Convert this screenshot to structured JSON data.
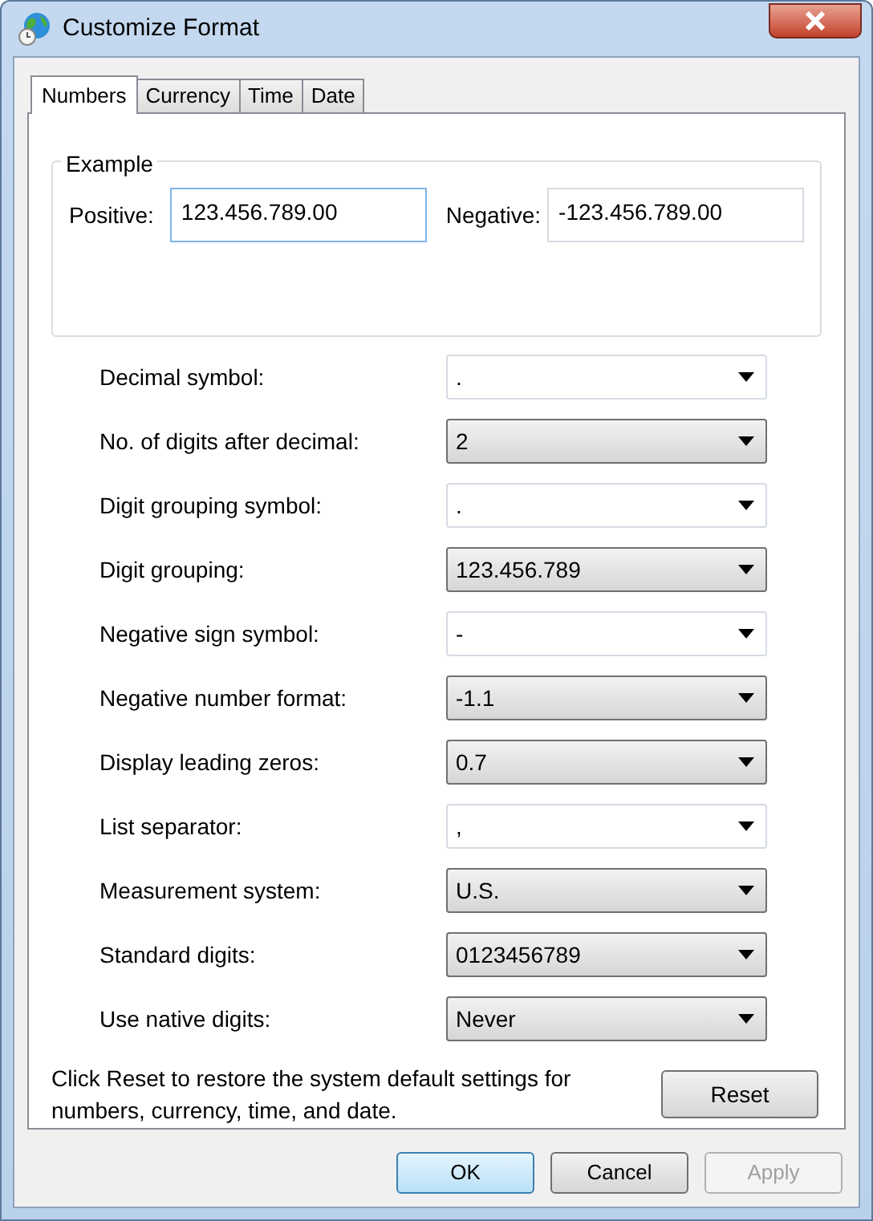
{
  "window": {
    "title": "Customize Format"
  },
  "tabs": [
    {
      "label": "Numbers",
      "selected": true
    },
    {
      "label": "Currency",
      "selected": false
    },
    {
      "label": "Time",
      "selected": false
    },
    {
      "label": "Date",
      "selected": false
    }
  ],
  "example": {
    "title": "Example",
    "positive_label": "Positive:",
    "positive_value": "123.456.789.00",
    "negative_label": "Negative:",
    "negative_value": "-123.456.789.00"
  },
  "settings": [
    {
      "label": "Decimal symbol:",
      "value": ".",
      "kind": "editable"
    },
    {
      "label": "No. of digits after decimal:",
      "value": "2",
      "kind": "list"
    },
    {
      "label": "Digit grouping symbol:",
      "value": ".",
      "kind": "editable"
    },
    {
      "label": "Digit grouping:",
      "value": "123.456.789",
      "kind": "list"
    },
    {
      "label": "Negative sign symbol:",
      "value": "-",
      "kind": "editable"
    },
    {
      "label": "Negative number format:",
      "value": "-1.1",
      "kind": "list"
    },
    {
      "label": "Display leading zeros:",
      "value": "0.7",
      "kind": "list"
    },
    {
      "label": "List separator:",
      "value": ",",
      "kind": "editable"
    },
    {
      "label": "Measurement system:",
      "value": "U.S.",
      "kind": "list"
    },
    {
      "label": "Standard digits:",
      "value": "0123456789",
      "kind": "list"
    },
    {
      "label": "Use native digits:",
      "value": "Never",
      "kind": "list"
    }
  ],
  "reset_note": "Click Reset to restore the system default settings for numbers, currency, time, and date.",
  "reset_button": "Reset",
  "buttons": [
    {
      "label": "OK",
      "default": true,
      "disabled": false
    },
    {
      "label": "Cancel",
      "default": false,
      "disabled": false
    },
    {
      "label": "Apply",
      "default": false,
      "disabled": true
    }
  ]
}
